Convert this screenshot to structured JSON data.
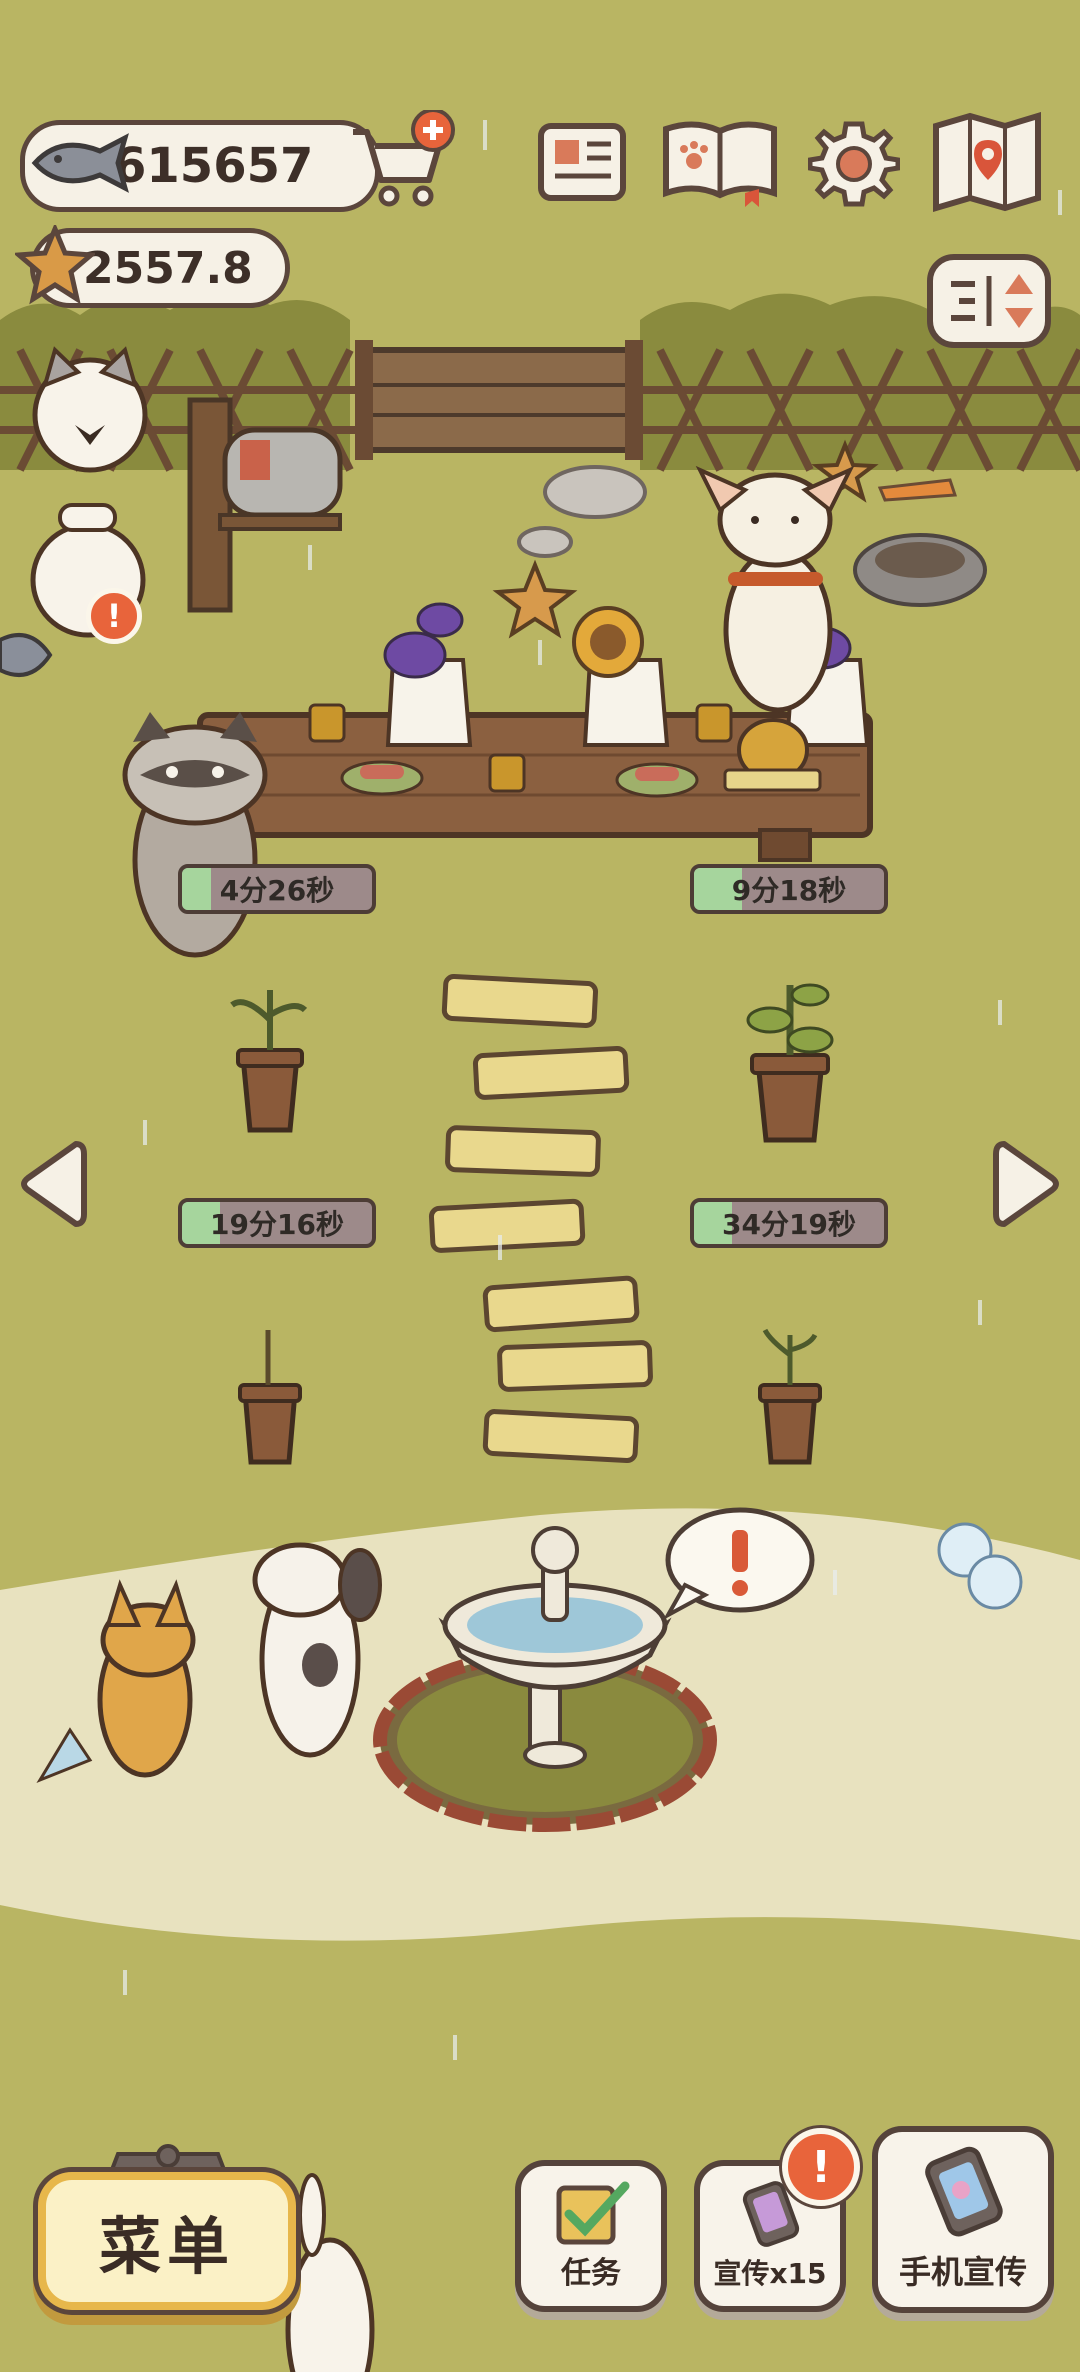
{
  "currency": {
    "fish": "615657",
    "stars": "2557.8"
  },
  "timers": [
    {
      "text": "4分26秒",
      "progress": 0.15
    },
    {
      "text": "9分18秒",
      "progress": 0.25
    },
    {
      "text": "19分16秒",
      "progress": 0.2
    },
    {
      "text": "34分19秒",
      "progress": 0.2
    }
  ],
  "bottom": {
    "menu": "菜单",
    "tasks": "任务",
    "promo": "宣传x15",
    "phone_promo": "手机宣传"
  },
  "alert_glyph": "!",
  "icons": {
    "top_bar": [
      "fish-icon",
      "shop-cart-icon",
      "newspaper-icon",
      "paw-book-icon",
      "settings-gear-icon",
      "map-icon"
    ],
    "side": [
      "layout-toggle-icon",
      "arrow-left-icon",
      "arrow-right-icon"
    ]
  },
  "colors": {
    "ground": "#b9b563",
    "path": "#e8e2bf",
    "timer_fill": "#a6d59d",
    "timer_track": "#9d8a8a",
    "alert": "#e8643b",
    "outline": "#5b463c"
  }
}
